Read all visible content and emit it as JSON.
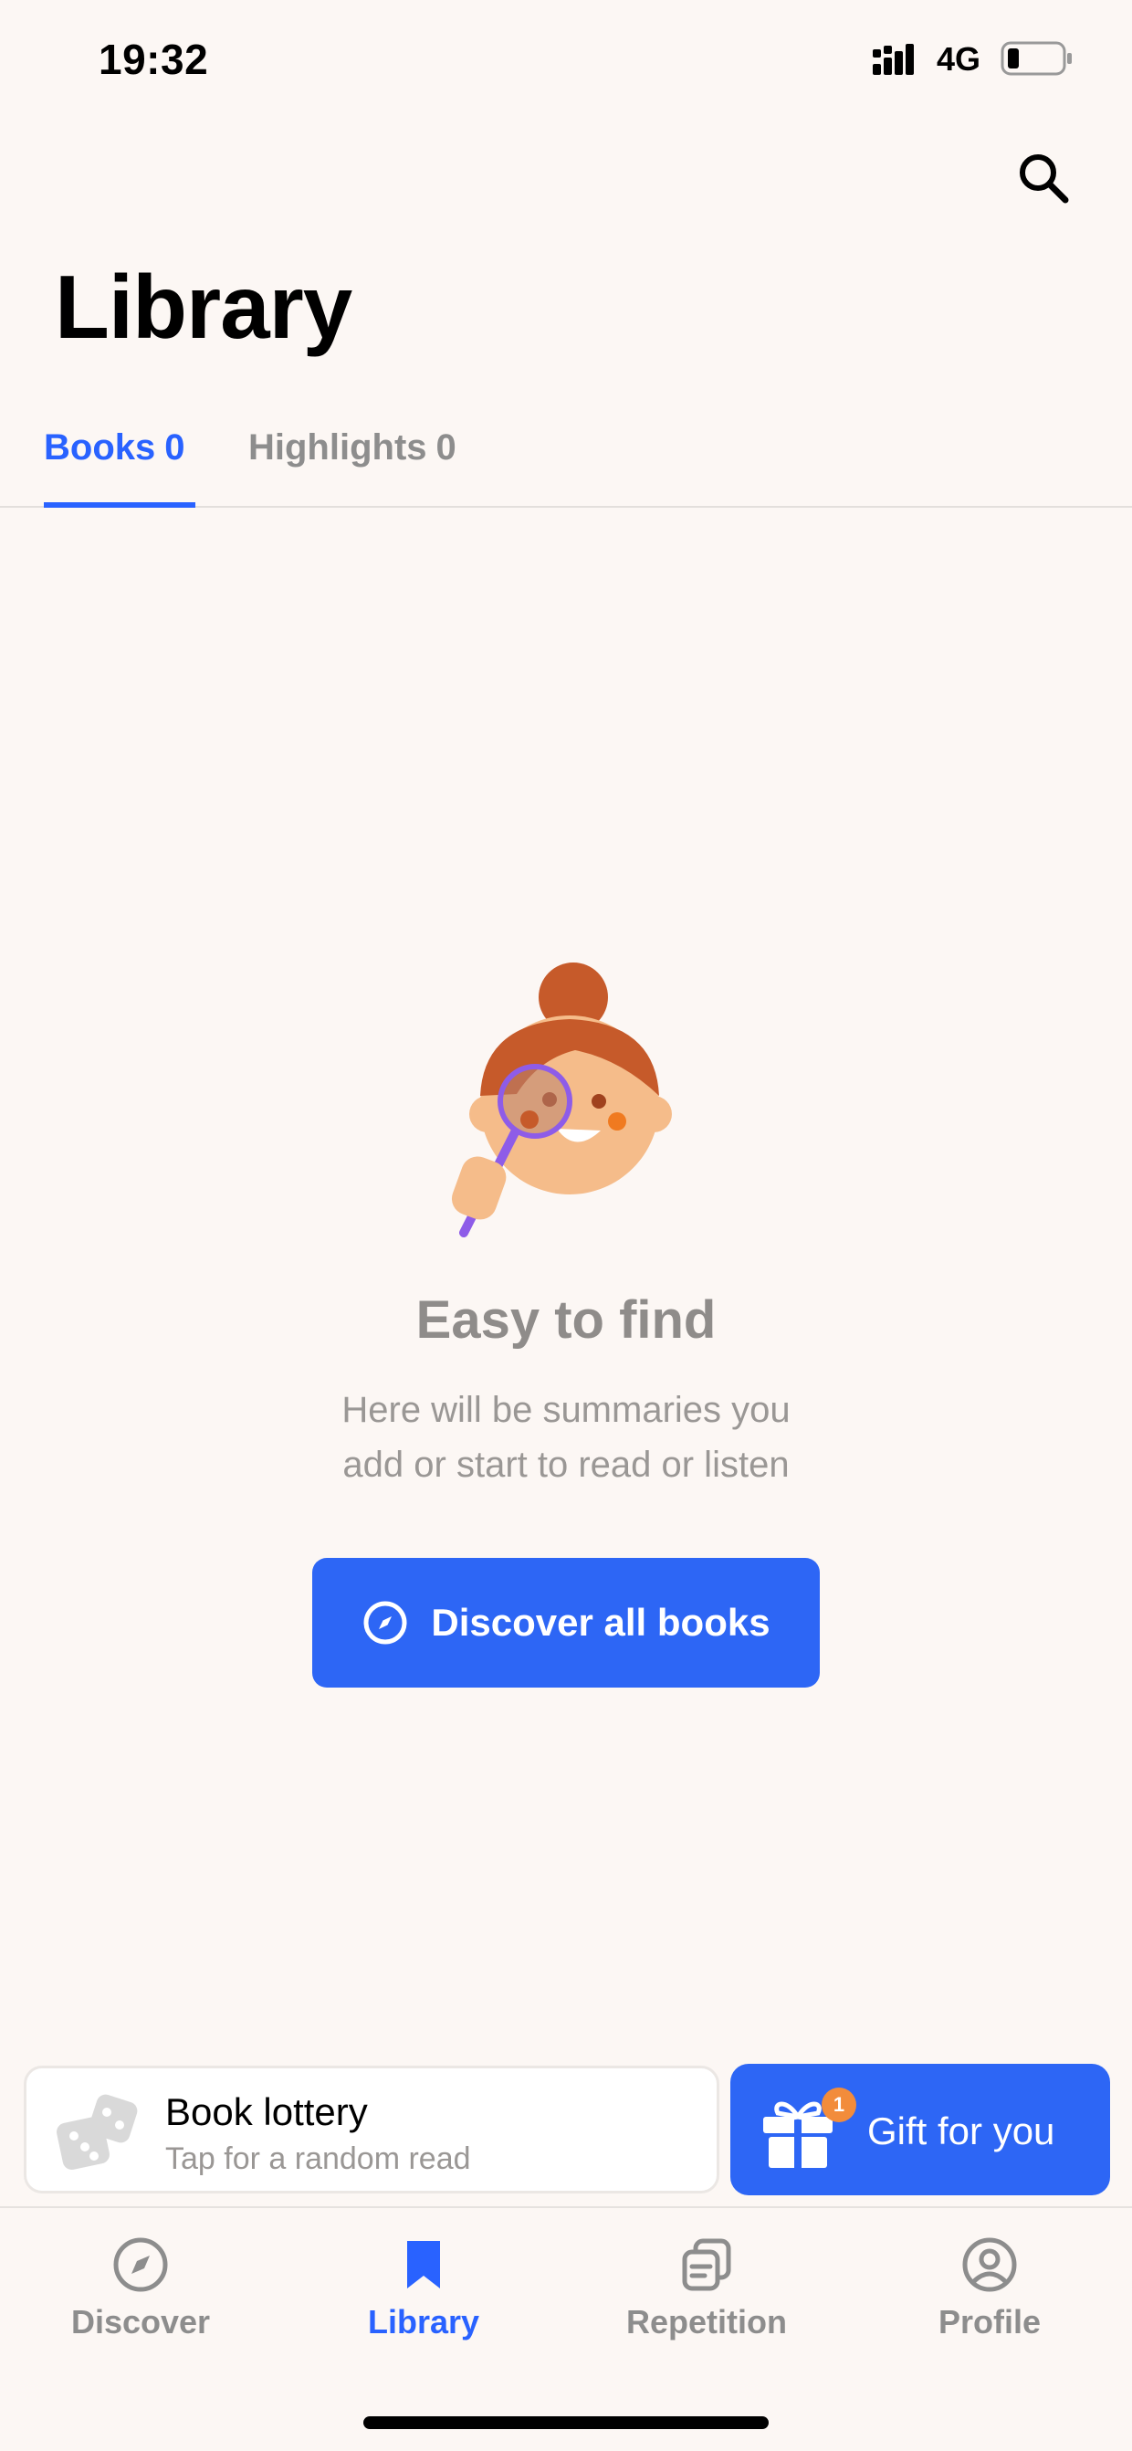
{
  "status_bar": {
    "time": "19:32",
    "network": "4G",
    "icons": [
      "signal-icon",
      "battery-icon"
    ]
  },
  "header": {
    "title": "Library",
    "search_icon": "search-icon"
  },
  "tabs": [
    {
      "label": "Books",
      "count": "0",
      "active": true
    },
    {
      "label": "Highlights",
      "count": "0",
      "active": false
    }
  ],
  "empty_state": {
    "illustration": "girl-with-magnifier-illustration",
    "title": "Easy to find",
    "description_line1": "Here will be summaries you",
    "description_line2": "add or start to read or listen",
    "button_label": "Discover all books",
    "button_icon": "compass-icon"
  },
  "promo": {
    "lottery_title": "Book lottery",
    "lottery_subtitle": "Tap for a random read",
    "lottery_icon": "dice-icon",
    "gift_label": "Gift for you",
    "gift_badge": "1",
    "gift_icon": "gift-icon"
  },
  "tab_bar": [
    {
      "label": "Discover",
      "icon": "compass-icon",
      "active": false
    },
    {
      "label": "Library",
      "icon": "bookmark-icon",
      "active": true
    },
    {
      "label": "Repetition",
      "icon": "cards-icon",
      "active": false
    },
    {
      "label": "Profile",
      "icon": "profile-icon",
      "active": false
    }
  ],
  "colors": {
    "background": "#fcf7f4",
    "accent": "#2962ff",
    "button": "#2d66f5",
    "badge": "#f28c3b",
    "muted_text": "#8d8d8d"
  }
}
